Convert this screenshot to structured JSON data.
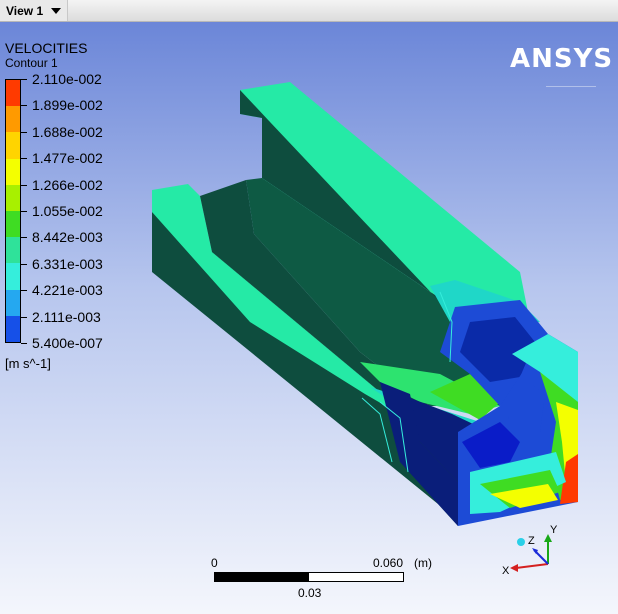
{
  "window": {
    "view_tab_label": "View 1"
  },
  "legend": {
    "title": "VELOCITIES",
    "subtitle": "Contour 1",
    "labels": [
      "2.110e-002",
      "1.899e-002",
      "1.688e-002",
      "1.477e-002",
      "1.266e-002",
      "1.055e-002",
      "8.442e-003",
      "6.331e-003",
      "4.221e-003",
      "2.111e-003",
      "5.400e-007"
    ],
    "units": "[m s^-1]",
    "colors": [
      "#ff3a00",
      "#ff9a00",
      "#ffd400",
      "#f4ff00",
      "#a8f000",
      "#3fdc23",
      "#2fe29a",
      "#35eedc",
      "#25a8f0",
      "#1650e8",
      "#0a1cc8"
    ]
  },
  "brand": {
    "logo_text": "ANSYS"
  },
  "scale": {
    "left": "0",
    "right": "0.060",
    "unit": "(m)",
    "mid": "0.03"
  },
  "triad": {
    "x": "X",
    "y": "Y",
    "z": "Z"
  },
  "model_colors": {
    "top_face": "#25eaa6",
    "side_dark": "#0e4d3e",
    "mid_cyan": "#1fd7c8",
    "blue_low": "#1d4bd6",
    "navy": "#0a1e7a"
  }
}
